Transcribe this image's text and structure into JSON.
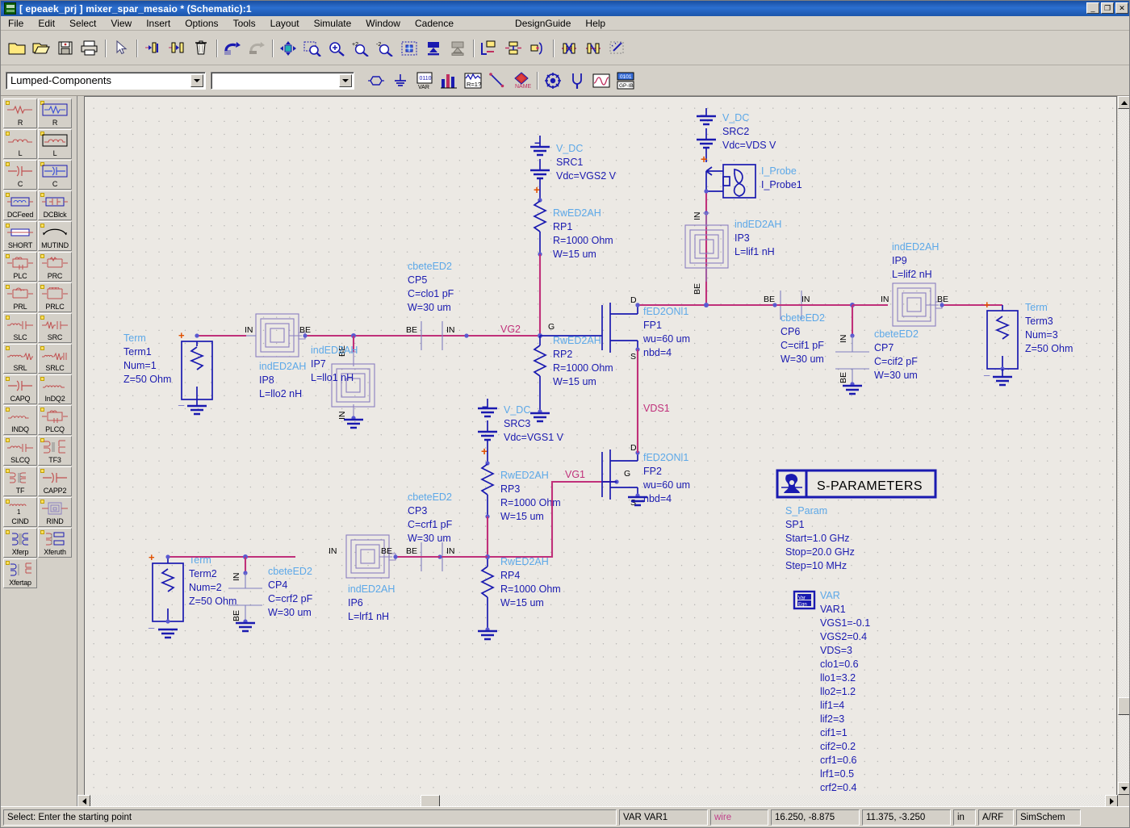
{
  "window": {
    "title": "[ epeaek_prj ] mixer_spar_mesaio * (Schematic):1",
    "icon": "schematic-icon",
    "minimize": "_",
    "maximize": "❐",
    "close": "✕"
  },
  "menubar": {
    "items": [
      {
        "label": "File"
      },
      {
        "label": "Edit"
      },
      {
        "label": "Select"
      },
      {
        "label": "View"
      },
      {
        "label": "Insert"
      },
      {
        "label": "Options"
      },
      {
        "label": "Tools"
      },
      {
        "label": "Layout"
      },
      {
        "label": "Simulate"
      },
      {
        "label": "Window"
      },
      {
        "label": "Cadence"
      },
      {
        "label": "DesignGuide"
      },
      {
        "label": "Help"
      }
    ]
  },
  "toolbar1": {
    "buttons": [
      {
        "name": "new-icon"
      },
      {
        "name": "open-icon"
      },
      {
        "name": "save-icon"
      },
      {
        "name": "print-icon"
      },
      {
        "name": "select-arrow-icon"
      },
      {
        "name": "push-into-hierarchy-icon"
      },
      {
        "name": "pop-out-hierarchy-icon"
      },
      {
        "name": "delete-icon"
      },
      {
        "name": "undo-icon"
      },
      {
        "name": "redo-icon"
      },
      {
        "name": "pan-icon"
      },
      {
        "name": "zoom-area-icon"
      },
      {
        "name": "zoom-in-icon"
      },
      {
        "name": "zoom-in-2x-icon"
      },
      {
        "name": "zoom-out-2x-icon"
      },
      {
        "name": "view-all-icon"
      },
      {
        "name": "insert-wire-icon"
      },
      {
        "name": "insert-pin-icon"
      },
      {
        "name": "wire-label-icon"
      },
      {
        "name": "wire-name-icon"
      },
      {
        "name": "node-name-icon"
      },
      {
        "name": "deactivate-icon"
      },
      {
        "name": "activate-icon"
      },
      {
        "name": "tune-parameters-icon"
      }
    ]
  },
  "toolbar2": {
    "library_select": {
      "value": "Lumped-Components",
      "placeholder": "Lumped-Components"
    },
    "component_select": {
      "value": "",
      "placeholder": ""
    },
    "buttons": [
      {
        "name": "insert-port-icon"
      },
      {
        "name": "insert-ground-icon"
      },
      {
        "name": "var-equation-icon"
      },
      {
        "name": "tune-icon"
      },
      {
        "name": "display-parameter-icon"
      },
      {
        "name": "insert-wire-diag-icon"
      },
      {
        "name": "wire-name-icon"
      },
      {
        "name": "optim-cockpit-icon"
      },
      {
        "name": "tuning-fork-icon"
      },
      {
        "name": "simulate-icon"
      },
      {
        "name": "instrument-icon"
      }
    ]
  },
  "palette": {
    "items": [
      {
        "label": "R",
        "icon": "resistor-icon"
      },
      {
        "label": "R",
        "icon": "resistor-boxed-icon"
      },
      {
        "label": "L",
        "icon": "inductor-icon"
      },
      {
        "label": "L",
        "icon": "inductor-boxed-icon"
      },
      {
        "label": "C",
        "icon": "capacitor-icon"
      },
      {
        "label": "C",
        "icon": "capacitor-boxed-icon"
      },
      {
        "label": "DCFeed",
        "icon": "dcfeed-icon"
      },
      {
        "label": "DCBlck",
        "icon": "dcblock-icon"
      },
      {
        "label": "SHORT",
        "icon": "short-icon"
      },
      {
        "label": "MUTIND",
        "icon": "mutual-inductance-icon"
      },
      {
        "label": "PLC",
        "icon": "plc-icon"
      },
      {
        "label": "PRC",
        "icon": "prc-icon"
      },
      {
        "label": "PRL",
        "icon": "prl-icon"
      },
      {
        "label": "PRLC",
        "icon": "prlc-icon"
      },
      {
        "label": "SLC",
        "icon": "slc-icon"
      },
      {
        "label": "SRC",
        "icon": "src-icon"
      },
      {
        "label": "SRL",
        "icon": "srl-icon"
      },
      {
        "label": "SRLC",
        "icon": "srlc-icon"
      },
      {
        "label": "CAPQ",
        "icon": "capq-icon"
      },
      {
        "label": "InDQ2",
        "icon": "indq2-icon"
      },
      {
        "label": "INDQ",
        "icon": "indq-icon"
      },
      {
        "label": "PLCQ",
        "icon": "plcq-icon"
      },
      {
        "label": "SLCQ",
        "icon": "slcq-icon"
      },
      {
        "label": "TF3",
        "icon": "transformer3-icon"
      },
      {
        "label": "TF",
        "icon": "transformer-icon"
      },
      {
        "label": "CAPP2",
        "icon": "capp2-icon"
      },
      {
        "label": "CIND",
        "icon": "cind-icon"
      },
      {
        "label": "RIND",
        "icon": "rind-icon"
      },
      {
        "label": "Xferp",
        "icon": "xferp-icon"
      },
      {
        "label": "Xferuth",
        "icon": "xferuth-icon"
      },
      {
        "label": "Xfertap",
        "icon": "xfertap-icon"
      }
    ]
  },
  "schematic": {
    "components": {
      "term1": {
        "type": "Term",
        "name": "Term1",
        "num": "Num=1",
        "z": "Z=50 Ohm"
      },
      "term2": {
        "type": "Term",
        "name": "Term2",
        "num": "Num=2",
        "z": "Z=50 Ohm"
      },
      "term3": {
        "type": "Term",
        "name": "Term3",
        "num": "Num=3",
        "z": "Z=50 Ohm"
      },
      "src1": {
        "type": "V_DC",
        "name": "SRC1",
        "vdc": "Vdc=VGS2 V"
      },
      "src2": {
        "type": "V_DC",
        "name": "SRC2",
        "vdc": "Vdc=VDS V"
      },
      "src3": {
        "type": "V_DC",
        "name": "SRC3",
        "vdc": "Vdc=VGS1 V"
      },
      "iprobe1": {
        "type": "I_Probe",
        "name": "I_Probe1"
      },
      "rp1": {
        "type": "RwED2AH",
        "name": "RP1",
        "r": "R=1000 Ohm",
        "w": "W=15 um"
      },
      "rp2": {
        "type": "RwED2AH",
        "name": "RP2",
        "r": "R=1000 Ohm",
        "w": "W=15 um"
      },
      "rp3": {
        "type": "RwED2AH",
        "name": "RP3",
        "r": "R=1000 Ohm",
        "w": "W=15 um"
      },
      "rp4": {
        "type": "RwED2AH",
        "name": "RP4",
        "r": "R=1000 Ohm",
        "w": "W=15 um"
      },
      "cp3": {
        "type": "cbeteED2",
        "name": "CP3",
        "c": "C=crf1 pF",
        "w": "W=30 um"
      },
      "cp4": {
        "type": "cbeteED2",
        "name": "CP4",
        "c": "C=crf2 pF",
        "w": "W=30 um"
      },
      "cp5": {
        "type": "cbeteED2",
        "name": "CP5",
        "c": "C=clo1 pF",
        "w": "W=30 um"
      },
      "cp6": {
        "type": "cbeteED2",
        "name": "CP6",
        "c": "C=cif1 pF",
        "w": "W=30 um"
      },
      "cp7": {
        "type": "cbeteED2",
        "name": "CP7",
        "c": "C=cif2 pF",
        "w": "W=30 um"
      },
      "ip3": {
        "type": "indED2AH",
        "name": "IP3",
        "l": "L=lif1 nH"
      },
      "ip6": {
        "type": "indED2AH",
        "name": "IP6",
        "l": "L=lrf1 nH"
      },
      "ip7": {
        "type": "indED2AH",
        "name": "IP7",
        "l": "L=llo1 nH"
      },
      "ip8": {
        "type": "indED2AH",
        "name": "IP8",
        "l": "L=llo2 nH"
      },
      "ip9": {
        "type": "indED2AH",
        "name": "IP9",
        "l": "L=lif2 nH"
      },
      "fp1": {
        "type": "fED2ONl1",
        "name": "FP1",
        "wu": "wu=60 um",
        "nbd": "nbd=4"
      },
      "fp2": {
        "type": "fED2ONl1",
        "name": "FP2",
        "wu": "wu=60 um",
        "nbd": "nbd=4"
      }
    },
    "net_labels": {
      "vg1": "VG1",
      "vg2": "VG2",
      "vds1": "VDS1"
    },
    "pin_labels": {
      "be": "BE",
      "in": "IN",
      "d": "D",
      "g": "G",
      "s": "S"
    },
    "sparam_block": {
      "header": "S-PARAMETERS",
      "type": "S_Param",
      "name": "SP1",
      "start": "Start=1.0 GHz",
      "stop": "Stop=20.0 GHz",
      "step": "Step=10 MHz",
      "icon": "s-parameters-icon"
    },
    "var_block": {
      "icon": "var-eqn-icon",
      "type": "VAR",
      "name": "VAR1",
      "vars": [
        "VGS1=-0.1",
        "VGS2=0.4",
        "VDS=3",
        "clo1=0.6",
        "llo1=3.2",
        "llo2=1.2",
        "lif1=4",
        "lif2=3",
        "cif1=1",
        "cif2=0.2",
        "crf1=0.6",
        "lrf1=0.5",
        "crf2=0.4"
      ]
    }
  },
  "statusbar": {
    "message": "Select: Enter the starting point",
    "selection": "VAR VAR1",
    "mode": "wire",
    "coord_abs": "16.250, -8.875",
    "coord_rel": "11.375, -3.250",
    "units": "in",
    "library": "A/RF",
    "context": "SimSchem"
  },
  "colors": {
    "wire_pink": "#c0307a",
    "component_blue": "#1a1ab0",
    "type_label_blue": "#5ca8e8",
    "inductor_purple": "#8a7fbf",
    "plus_orange": "#e05000",
    "canvas_bg": "#ece9e4",
    "chrome_bg": "#d4d0c8",
    "titlebar_blue": "#1a4fa0"
  }
}
